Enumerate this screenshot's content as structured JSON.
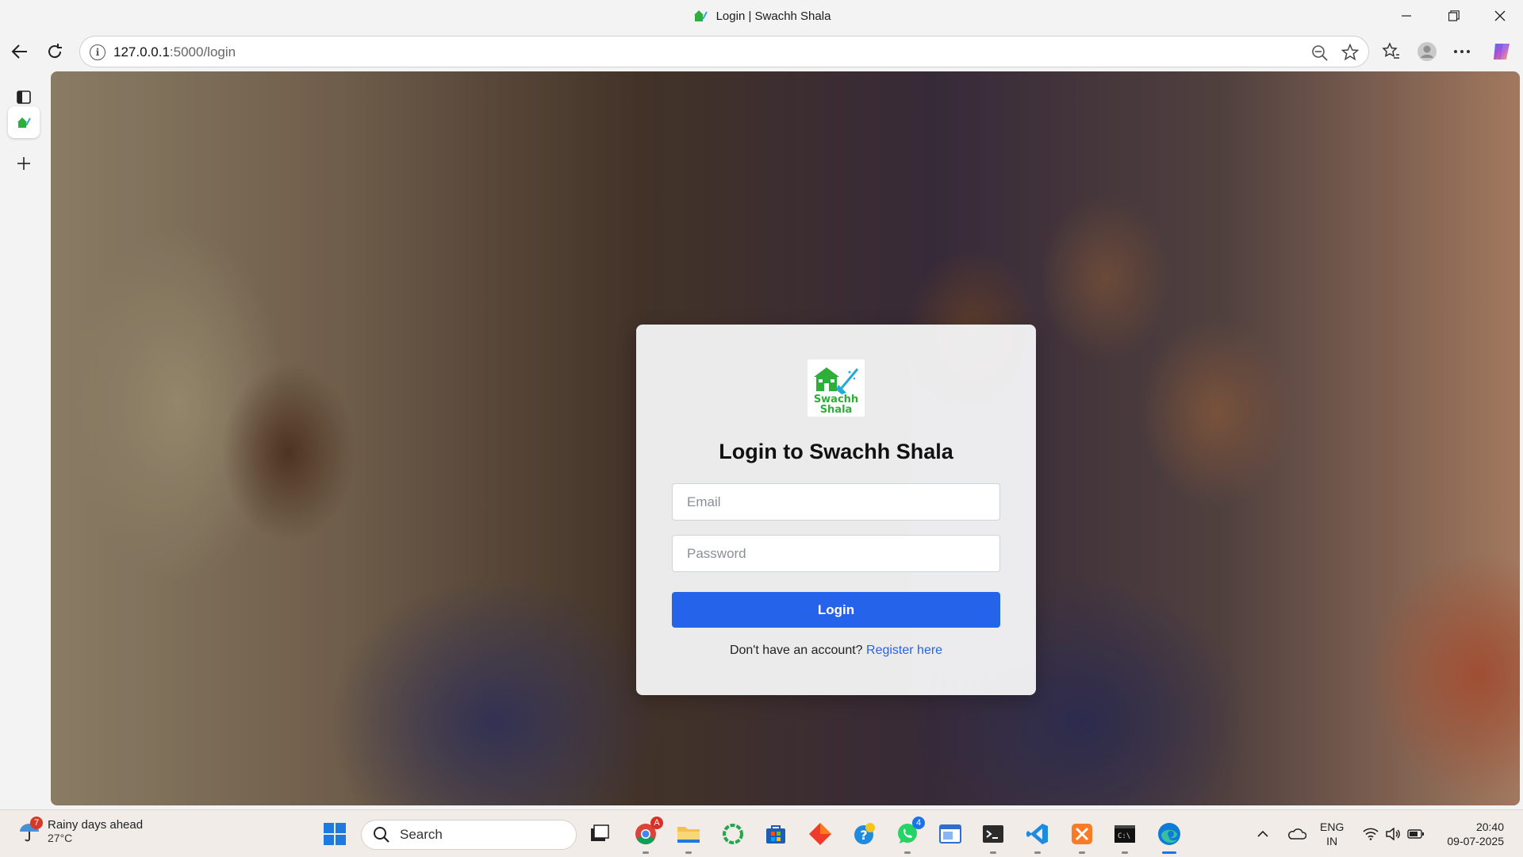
{
  "window": {
    "title": "Login | Swachh Shala"
  },
  "address_bar": {
    "host": "127.0.0.1",
    "path": ":5000/login"
  },
  "login": {
    "logo_line1": "Swachh",
    "logo_line2": "Shala",
    "heading": "Login to Swachh Shala",
    "email_placeholder": "Email",
    "password_placeholder": "Password",
    "login_button": "Login",
    "register_prompt": "Don't have an account?",
    "register_link": "Register here"
  },
  "taskbar": {
    "weather_title": "Rainy days ahead",
    "weather_temp": "27°C",
    "weather_badge": "7",
    "search_label": "Search",
    "chrome_badge": "A",
    "whatsapp_badge": "4",
    "lang_line1": "ENG",
    "lang_line2": "IN",
    "time": "20:40",
    "date": "09-07-2025"
  },
  "colors": {
    "accent": "#2563eb",
    "brand_green": "#2eaf3a"
  }
}
